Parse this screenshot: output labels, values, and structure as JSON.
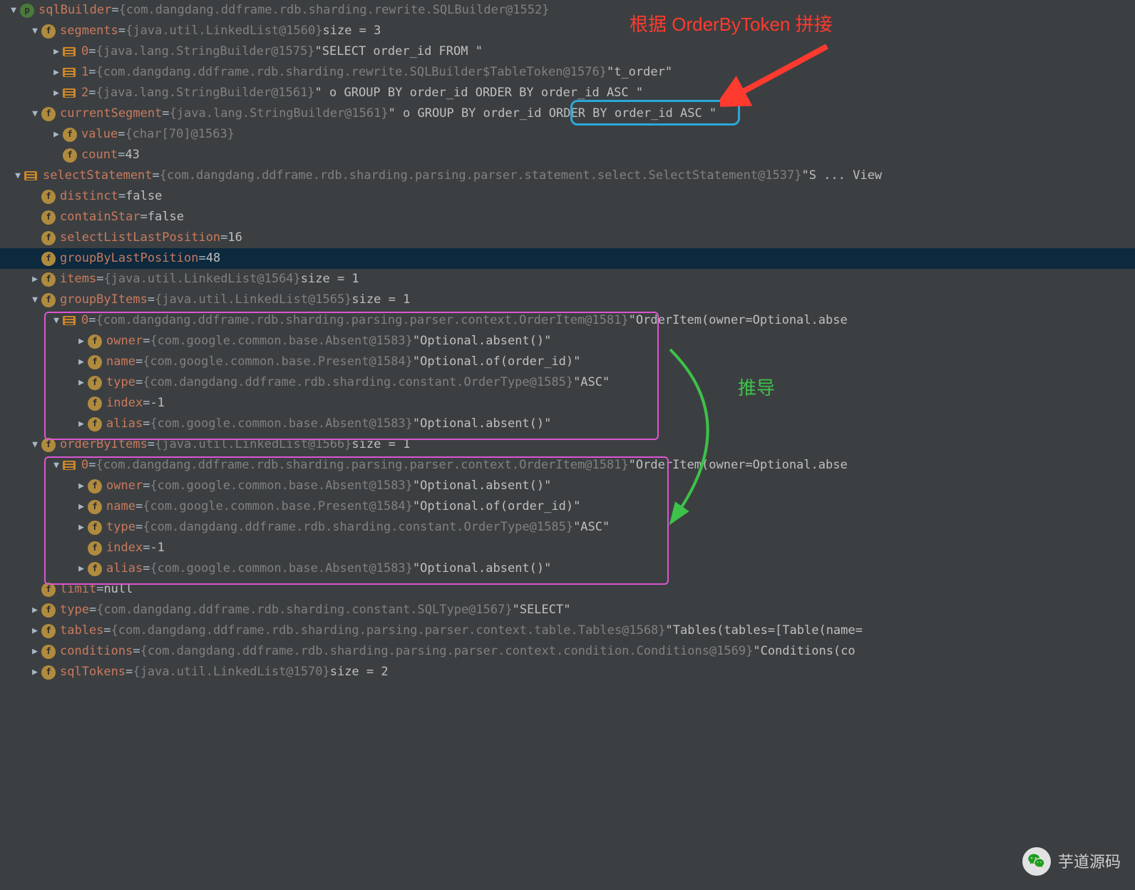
{
  "rows": [
    {
      "indent": "i0",
      "arrow": "down",
      "icon": "p",
      "field": "sqlBuilder",
      "eq": " = ",
      "dim": "{com.dangdang.ddframe.rdb.sharding.rewrite.SQLBuilder@1552}",
      "str": ""
    },
    {
      "indent": "i1",
      "arrow": "down",
      "icon": "f",
      "inh": true,
      "field": "segments",
      "eq": " = ",
      "dim": "{java.util.LinkedList@1560}",
      "str": "  size = 3"
    },
    {
      "indent": "i2",
      "arrow": "right",
      "icon": "dot",
      "field": "0",
      "eq": " = ",
      "dim": "{java.lang.StringBuilder@1575}",
      "str": " \"SELECT order_id FROM \""
    },
    {
      "indent": "i2",
      "arrow": "right",
      "icon": "dot",
      "field": "1",
      "eq": " = ",
      "dim": "{com.dangdang.ddframe.rdb.sharding.rewrite.SQLBuilder$TableToken@1576}",
      "str": " \"t_order\""
    },
    {
      "indent": "i2",
      "arrow": "right",
      "icon": "dot",
      "field": "2",
      "eq": " = ",
      "dim": "{java.lang.StringBuilder@1561}",
      "str": " \" o GROUP BY order_id ORDER BY order_id ASC \""
    },
    {
      "indent": "i1",
      "arrow": "down",
      "icon": "f",
      "field": "currentSegment",
      "eq": " = ",
      "dim": "{java.lang.StringBuilder@1561}",
      "str": " \" o GROUP BY order_id ORDER BY order_id ASC \""
    },
    {
      "indent": "i2",
      "arrow": "right",
      "icon": "f",
      "field": "value",
      "eq": " = ",
      "dim": "{char[70]@1563}",
      "str": ""
    },
    {
      "indent": "i2",
      "arrow": "",
      "icon": "f",
      "field": "count",
      "eq": " = ",
      "dim": "",
      "str": "43"
    },
    {
      "indent": "i0",
      "arrow": "down",
      "icon": "dot",
      "noIndent": true,
      "preArrow": true,
      "field": "selectStatement",
      "eq": " = ",
      "dim": "{com.dangdang.ddframe.rdb.sharding.parsing.parser.statement.select.SelectStatement@1537}",
      "str": " \"S ...  View"
    },
    {
      "indent": "i1",
      "arrow": "",
      "icon": "f",
      "field": "distinct",
      "eq": " = ",
      "dim": "",
      "str": "false"
    },
    {
      "indent": "i1",
      "arrow": "",
      "icon": "f",
      "field": "containStar",
      "eq": " = ",
      "dim": "",
      "str": "false"
    },
    {
      "indent": "i1",
      "arrow": "",
      "icon": "f",
      "field": "selectListLastPosition",
      "eq": " = ",
      "dim": "",
      "str": "16"
    },
    {
      "indent": "i1",
      "arrow": "",
      "icon": "f",
      "field": "groupByLastPosition",
      "eq": " = ",
      "dim": "",
      "str": "48",
      "highlighted": true
    },
    {
      "indent": "i1",
      "arrow": "right",
      "icon": "f",
      "inh": true,
      "field": "items",
      "eq": " = ",
      "dim": "{java.util.LinkedList@1564}",
      "str": "  size = 1"
    },
    {
      "indent": "i1",
      "arrow": "down",
      "icon": "f",
      "inh": true,
      "field": "groupByItems",
      "eq": " = ",
      "dim": "{java.util.LinkedList@1565}",
      "str": "  size = 1"
    },
    {
      "indent": "i2",
      "arrow": "down",
      "icon": "dot",
      "field": "0",
      "eq": " = ",
      "dim": "{com.dangdang.ddframe.rdb.sharding.parsing.parser.context.OrderItem@1581}",
      "str": " \"OrderItem(owner=Optional.abse"
    },
    {
      "indent": "i3",
      "arrow": "right",
      "icon": "f",
      "inh": true,
      "field": "owner",
      "eq": " = ",
      "dim": "{com.google.common.base.Absent@1583}",
      "str": " \"Optional.absent()\""
    },
    {
      "indent": "i3",
      "arrow": "right",
      "icon": "f",
      "inh": true,
      "field": "name",
      "eq": " = ",
      "dim": "{com.google.common.base.Present@1584}",
      "str": " \"Optional.of(order_id)\""
    },
    {
      "indent": "i3",
      "arrow": "right",
      "icon": "f",
      "inh": true,
      "field": "type",
      "eq": " = ",
      "dim": "{com.dangdang.ddframe.rdb.sharding.constant.OrderType@1585}",
      "str": " \"ASC\""
    },
    {
      "indent": "i3",
      "arrow": "",
      "icon": "f",
      "field": "index",
      "eq": " = ",
      "dim": "",
      "str": "-1"
    },
    {
      "indent": "i3",
      "arrow": "right",
      "icon": "f",
      "field": "alias",
      "eq": " = ",
      "dim": "{com.google.common.base.Absent@1583}",
      "str": " \"Optional.absent()\""
    },
    {
      "indent": "i1",
      "arrow": "down",
      "icon": "f",
      "field": "orderByItems",
      "eq": " = ",
      "dim": "{java.util.LinkedList@1566}",
      "str": "  size = 1"
    },
    {
      "indent": "i2",
      "arrow": "down",
      "icon": "dot",
      "field": "0",
      "eq": " = ",
      "dim": "{com.dangdang.ddframe.rdb.sharding.parsing.parser.context.OrderItem@1581}",
      "str": " \"OrderItem(owner=Optional.abse"
    },
    {
      "indent": "i3",
      "arrow": "right",
      "icon": "f",
      "inh": true,
      "field": "owner",
      "eq": " = ",
      "dim": "{com.google.common.base.Absent@1583}",
      "str": " \"Optional.absent()\""
    },
    {
      "indent": "i3",
      "arrow": "right",
      "icon": "f",
      "inh": true,
      "field": "name",
      "eq": " = ",
      "dim": "{com.google.common.base.Present@1584}",
      "str": " \"Optional.of(order_id)\""
    },
    {
      "indent": "i3",
      "arrow": "right",
      "icon": "f",
      "inh": true,
      "field": "type",
      "eq": " = ",
      "dim": "{com.dangdang.ddframe.rdb.sharding.constant.OrderType@1585}",
      "str": " \"ASC\""
    },
    {
      "indent": "i3",
      "arrow": "",
      "icon": "f",
      "field": "index",
      "eq": " = ",
      "dim": "",
      "str": "-1"
    },
    {
      "indent": "i3",
      "arrow": "right",
      "icon": "f",
      "field": "alias",
      "eq": " = ",
      "dim": "{com.google.common.base.Absent@1583}",
      "str": " \"Optional.absent()\""
    },
    {
      "indent": "i1",
      "arrow": "",
      "icon": "f",
      "field": "limit",
      "eq": " = ",
      "dim": "",
      "str": "null"
    },
    {
      "indent": "i1",
      "arrow": "right",
      "icon": "f",
      "inh": true,
      "field": "type",
      "eq": " = ",
      "dim": "{com.dangdang.ddframe.rdb.sharding.constant.SQLType@1567}",
      "str": " \"SELECT\""
    },
    {
      "indent": "i1",
      "arrow": "right",
      "icon": "f",
      "inh": true,
      "field": "tables",
      "eq": " = ",
      "dim": "{com.dangdang.ddframe.rdb.sharding.parsing.parser.context.table.Tables@1568}",
      "str": " \"Tables(tables=[Table(name="
    },
    {
      "indent": "i1",
      "arrow": "right",
      "icon": "f",
      "inh": true,
      "field": "conditions",
      "eq": " = ",
      "dim": "{com.dangdang.ddframe.rdb.sharding.parsing.parser.context.condition.Conditions@1569}",
      "str": " \"Conditions(co"
    },
    {
      "indent": "i1",
      "arrow": "right",
      "icon": "f",
      "inh": true,
      "field": "sqlTokens",
      "eq": " = ",
      "dim": "{java.util.LinkedList@1570}",
      "str": "  size = 2"
    }
  ],
  "annotations": {
    "redLabel": "根据 OrderByToken 拼接",
    "greenLabel": "推导",
    "watermark": "芋道源码"
  }
}
